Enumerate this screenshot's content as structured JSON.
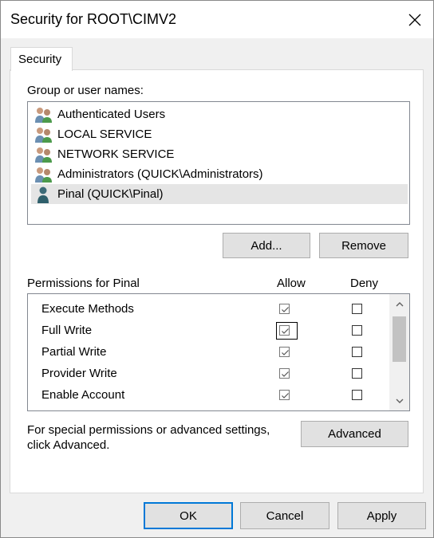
{
  "window": {
    "title": "Security for ROOT\\CIMV2",
    "close_icon": "close-icon"
  },
  "tabs": [
    {
      "label": "Security",
      "selected": true
    }
  ],
  "group_section": {
    "label": "Group or user names:",
    "items": [
      {
        "name": "Authenticated Users",
        "icon": "user-group-icon",
        "selected": false
      },
      {
        "name": "LOCAL SERVICE",
        "icon": "user-group-icon",
        "selected": false
      },
      {
        "name": "NETWORK SERVICE",
        "icon": "user-group-icon",
        "selected": false
      },
      {
        "name": "Administrators (QUICK\\Administrators)",
        "icon": "user-group-icon",
        "selected": false
      },
      {
        "name": "Pinal (QUICK\\Pinal)",
        "icon": "user-icon",
        "selected": true
      }
    ]
  },
  "buttons": {
    "add": "Add...",
    "remove": "Remove",
    "advanced": "Advanced",
    "ok": "OK",
    "cancel": "Cancel",
    "apply": "Apply"
  },
  "permissions": {
    "header": "Permissions for Pinal",
    "allow_header": "Allow",
    "deny_header": "Deny",
    "rows": [
      {
        "name": "Execute Methods",
        "allow": true,
        "deny": false
      },
      {
        "name": "Full Write",
        "allow": true,
        "deny": false
      },
      {
        "name": "Partial Write",
        "allow": true,
        "deny": false
      },
      {
        "name": "Provider Write",
        "allow": true,
        "deny": false
      },
      {
        "name": "Enable Account",
        "allow": true,
        "deny": false
      }
    ]
  },
  "advanced_note": "For special permissions or advanced settings,\nclick Advanced.",
  "colors": {
    "focus": "#0078d7",
    "selected_row": "#e5e5e5",
    "dialog_bg": "#f0f0f0"
  }
}
